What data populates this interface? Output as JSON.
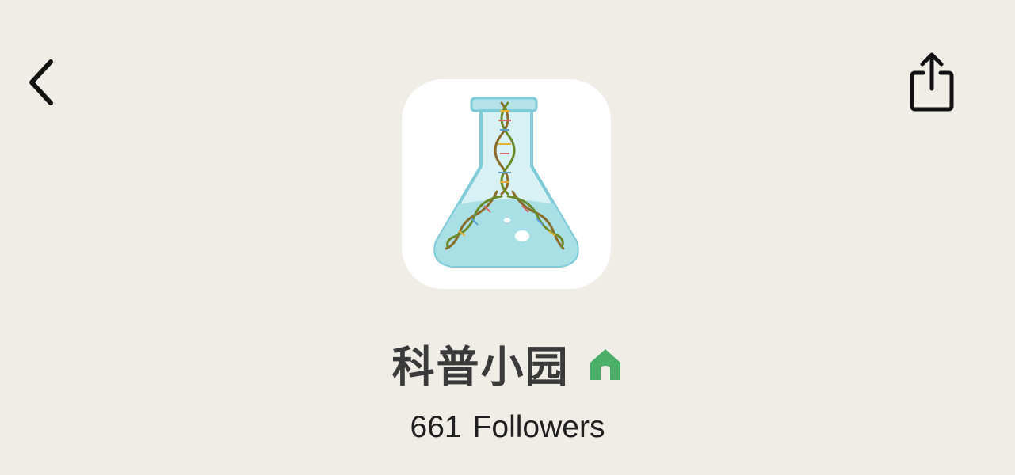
{
  "header": {
    "back_icon": "chevron-left-icon",
    "share_icon": "share-icon"
  },
  "profile": {
    "avatar_icon": "flask-dna-icon",
    "name": "科普小园",
    "badge_icon": "home-icon",
    "badge_color": "#4caf67",
    "followers_count": "661",
    "followers_label": "Followers"
  },
  "colors": {
    "background": "#efede6",
    "title_text": "#3a3a3a",
    "flask_fill": "#a9e0e6",
    "flask_outline": "#7fcbd8"
  }
}
